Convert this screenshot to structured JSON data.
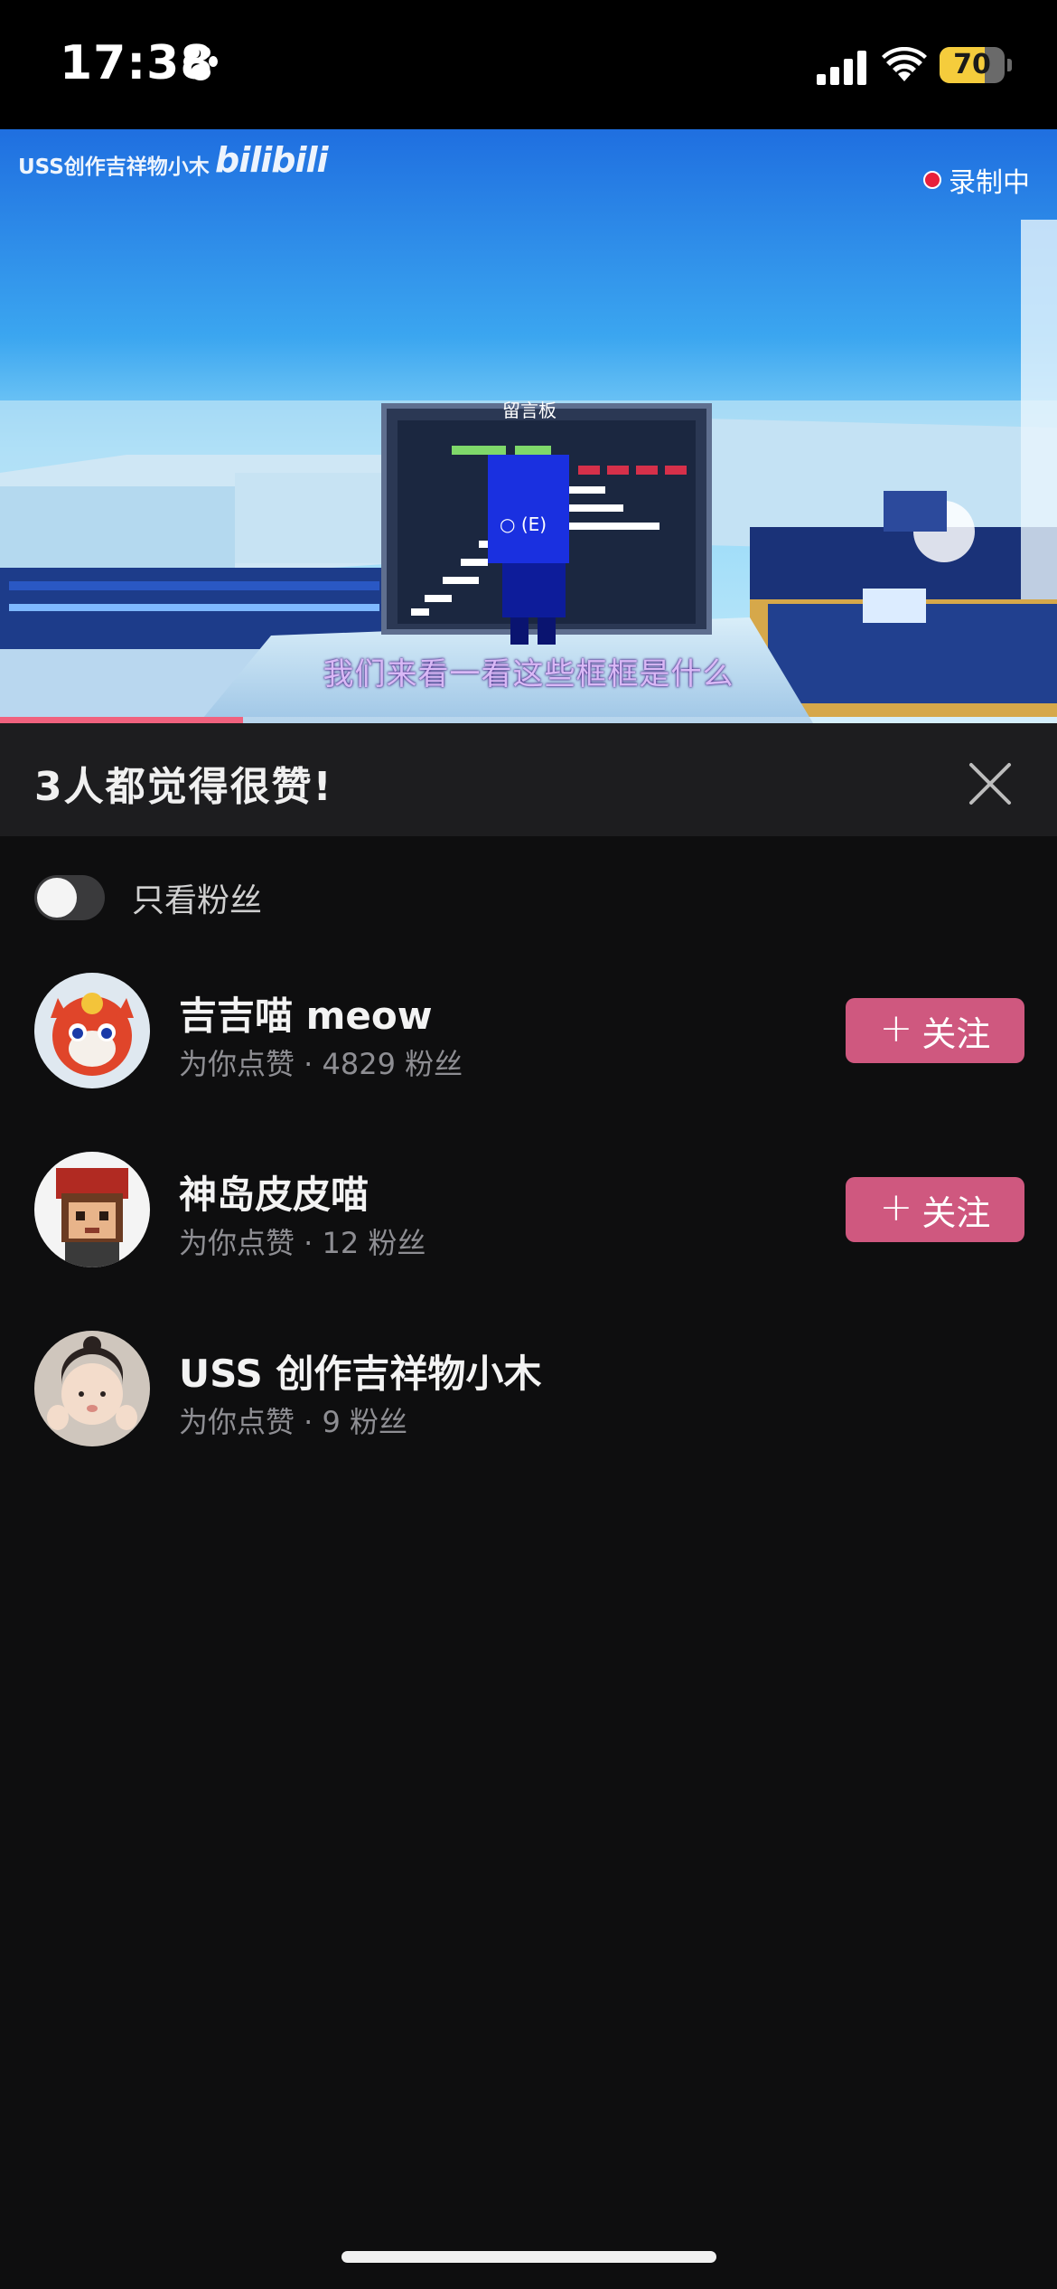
{
  "status_bar": {
    "time": "17:38",
    "battery_text": "70",
    "battery_level": 0.7,
    "battery_color": "#f5cc3c"
  },
  "video": {
    "uploader_watermark": "USS创作吉祥物小木",
    "logo_text": "bilibili",
    "recording_label": "录制中",
    "board_title": "留言板",
    "interact_hint": "(E)",
    "subtitle": "我们来看一看这些框框是什么",
    "progress": 0.23,
    "progress_color": "#f0627e"
  },
  "likes_sheet": {
    "title": "3人都觉得很赞!",
    "filter_label": "只看粉丝",
    "filter_on": false,
    "follow_label": "关注",
    "accent_color": "#cf587f",
    "users": [
      {
        "name": "吉吉喵 meow",
        "subtitle": "为你点赞 · 4829 粉丝",
        "show_follow": true
      },
      {
        "name": "神岛皮皮喵",
        "subtitle": "为你点赞 · 12 粉丝",
        "show_follow": true
      },
      {
        "name": "USS 创作吉祥物小木",
        "subtitle": "为你点赞 · 9 粉丝",
        "show_follow": false
      }
    ]
  }
}
